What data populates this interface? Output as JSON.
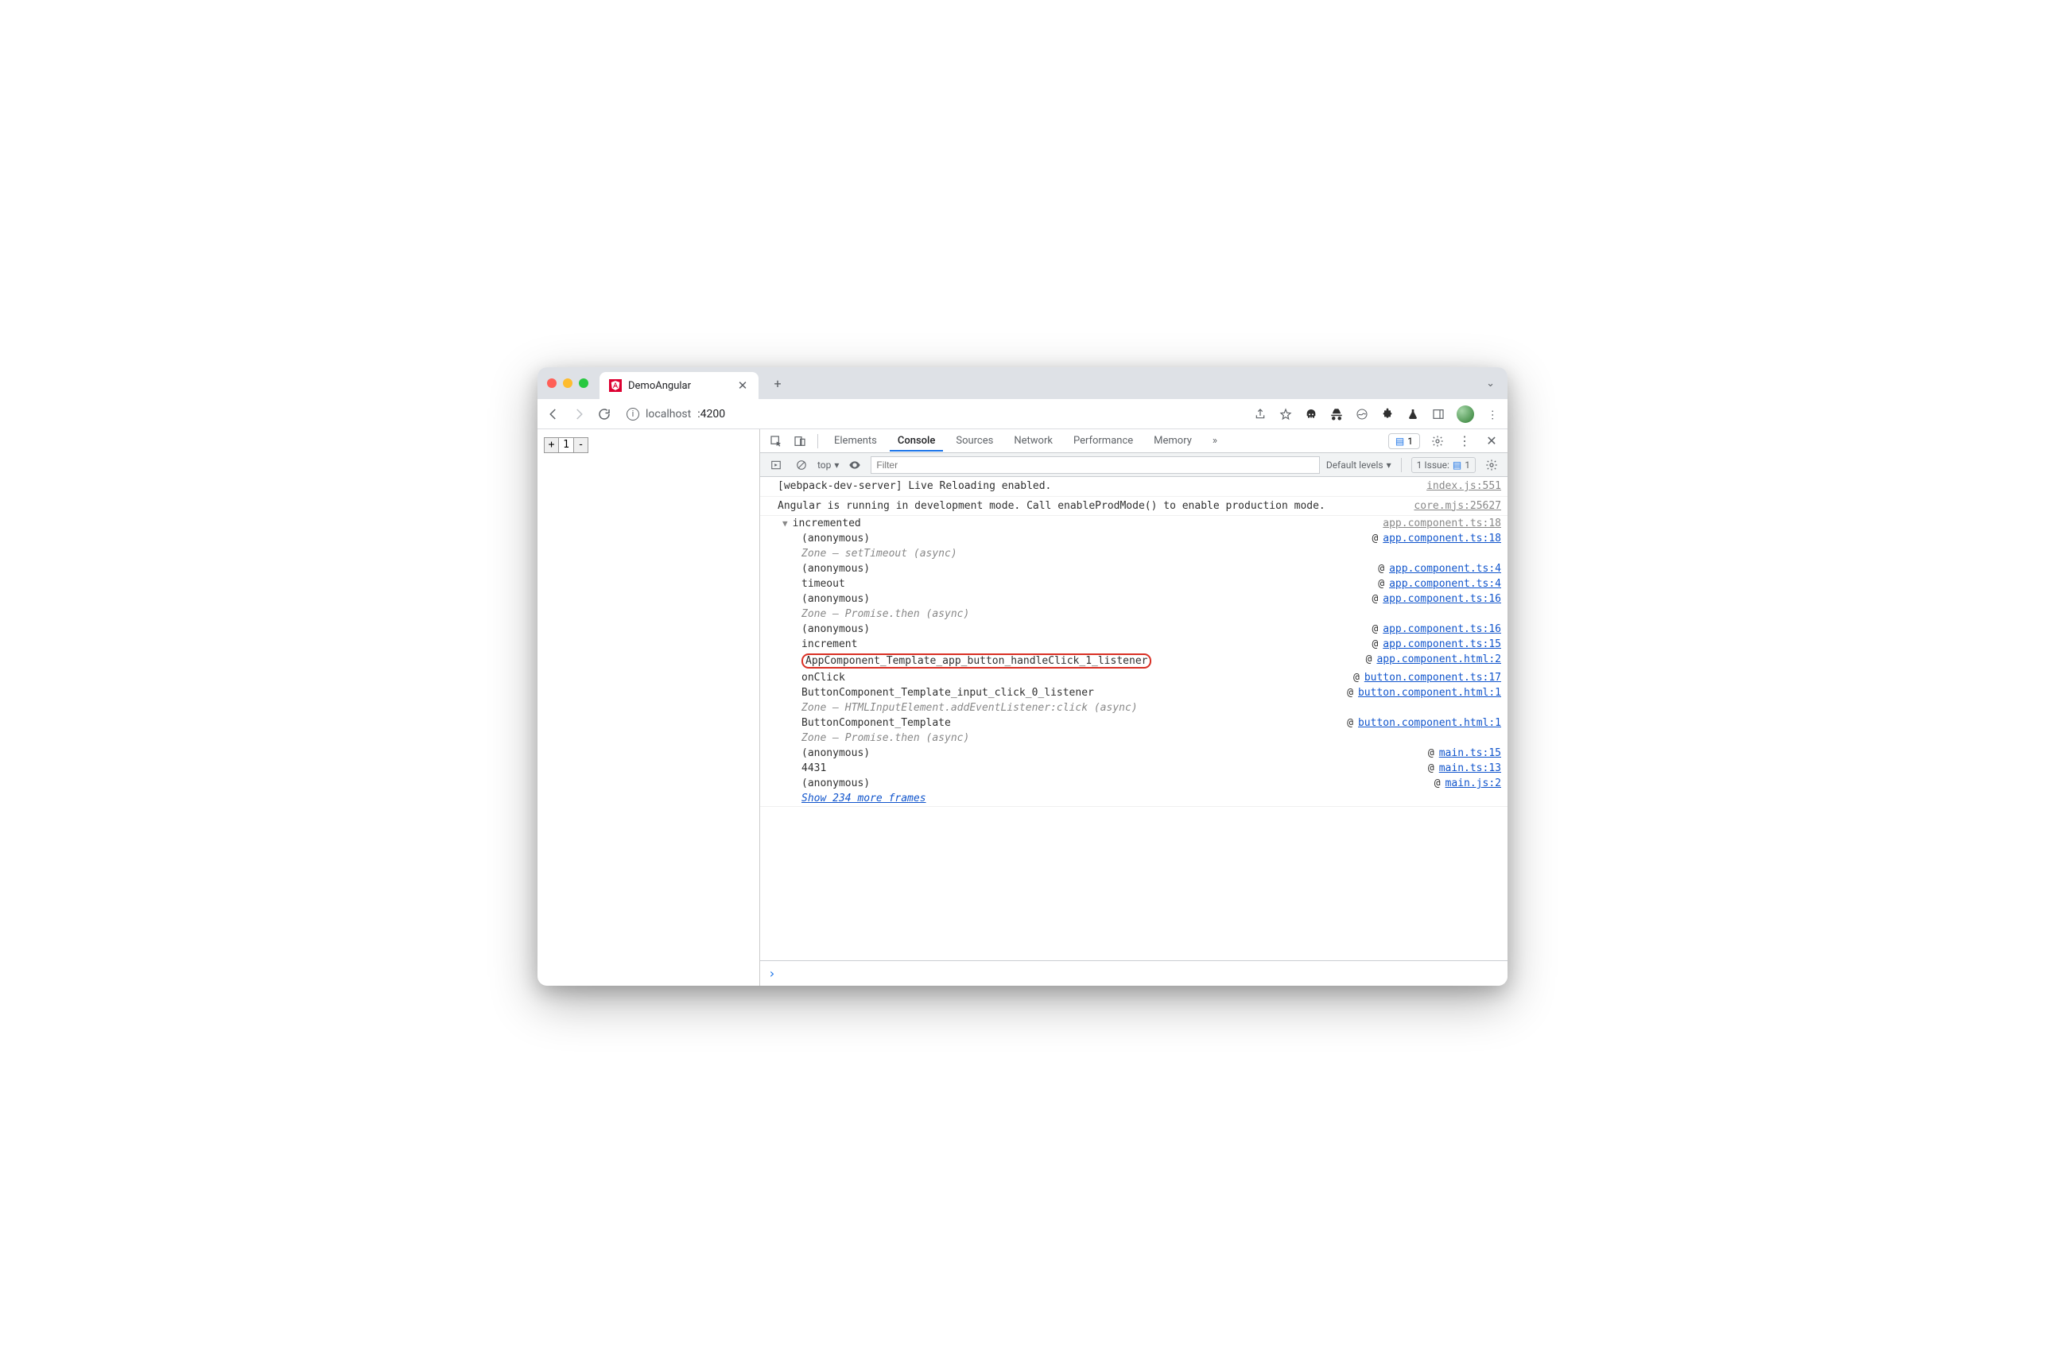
{
  "browser": {
    "tab_title": "DemoAngular",
    "url_host": "localhost",
    "url_port": ":4200"
  },
  "page": {
    "minus": "-",
    "plus": "+",
    "value": "1"
  },
  "devtools": {
    "tabs": {
      "elements": "Elements",
      "console": "Console",
      "sources": "Sources",
      "network": "Network",
      "performance": "Performance",
      "memory": "Memory"
    },
    "more_tabs_glyph": "»",
    "msg_count": "1",
    "filter_bar": {
      "context": "top",
      "filter_placeholder": "Filter",
      "default_levels": "Default levels",
      "issues_label": "1 Issue:",
      "issues_count": "1"
    }
  },
  "console": {
    "line1": {
      "text": "[webpack-dev-server] Live Reloading enabled.",
      "src": "index.js:551"
    },
    "line2": {
      "text": "Angular is running in development mode. Call enableProdMode() to enable production mode.",
      "src": "core.mjs:25627"
    },
    "group": {
      "title": "incremented",
      "src": "app.component.ts:18"
    },
    "stack": [
      {
        "fn": "(anonymous)",
        "src": "app.component.ts:18",
        "at": true
      },
      {
        "fn": "Zone – setTimeout (async)",
        "async": true
      },
      {
        "fn": "(anonymous)",
        "src": "app.component.ts:4",
        "at": true
      },
      {
        "fn": "timeout",
        "src": "app.component.ts:4",
        "at": true
      },
      {
        "fn": "(anonymous)",
        "src": "app.component.ts:16",
        "at": true
      },
      {
        "fn": "Zone – Promise.then (async)",
        "async": true
      },
      {
        "fn": "(anonymous)",
        "src": "app.component.ts:16",
        "at": true
      },
      {
        "fn": "increment",
        "src": "app.component.ts:15",
        "at": true
      },
      {
        "fn": "AppComponent_Template_app_button_handleClick_1_listener",
        "src": "app.component.html:2",
        "at": true,
        "highlight": true
      },
      {
        "fn": "onClick",
        "src": "button.component.ts:17",
        "at": true
      },
      {
        "fn": "ButtonComponent_Template_input_click_0_listener",
        "src": "button.component.html:1",
        "at": true
      },
      {
        "fn": "Zone – HTMLInputElement.addEventListener:click (async)",
        "async": true
      },
      {
        "fn": "ButtonComponent_Template",
        "src": "button.component.html:1",
        "at": true
      },
      {
        "fn": "Zone – Promise.then (async)",
        "async": true
      },
      {
        "fn": "(anonymous)",
        "src": "main.ts:15",
        "at": true
      },
      {
        "fn": "4431",
        "src": "main.ts:13",
        "at": true
      },
      {
        "fn": "(anonymous)",
        "src": "main.js:2",
        "at": true
      }
    ],
    "show_more": "Show 234 more frames",
    "prompt": "›"
  }
}
